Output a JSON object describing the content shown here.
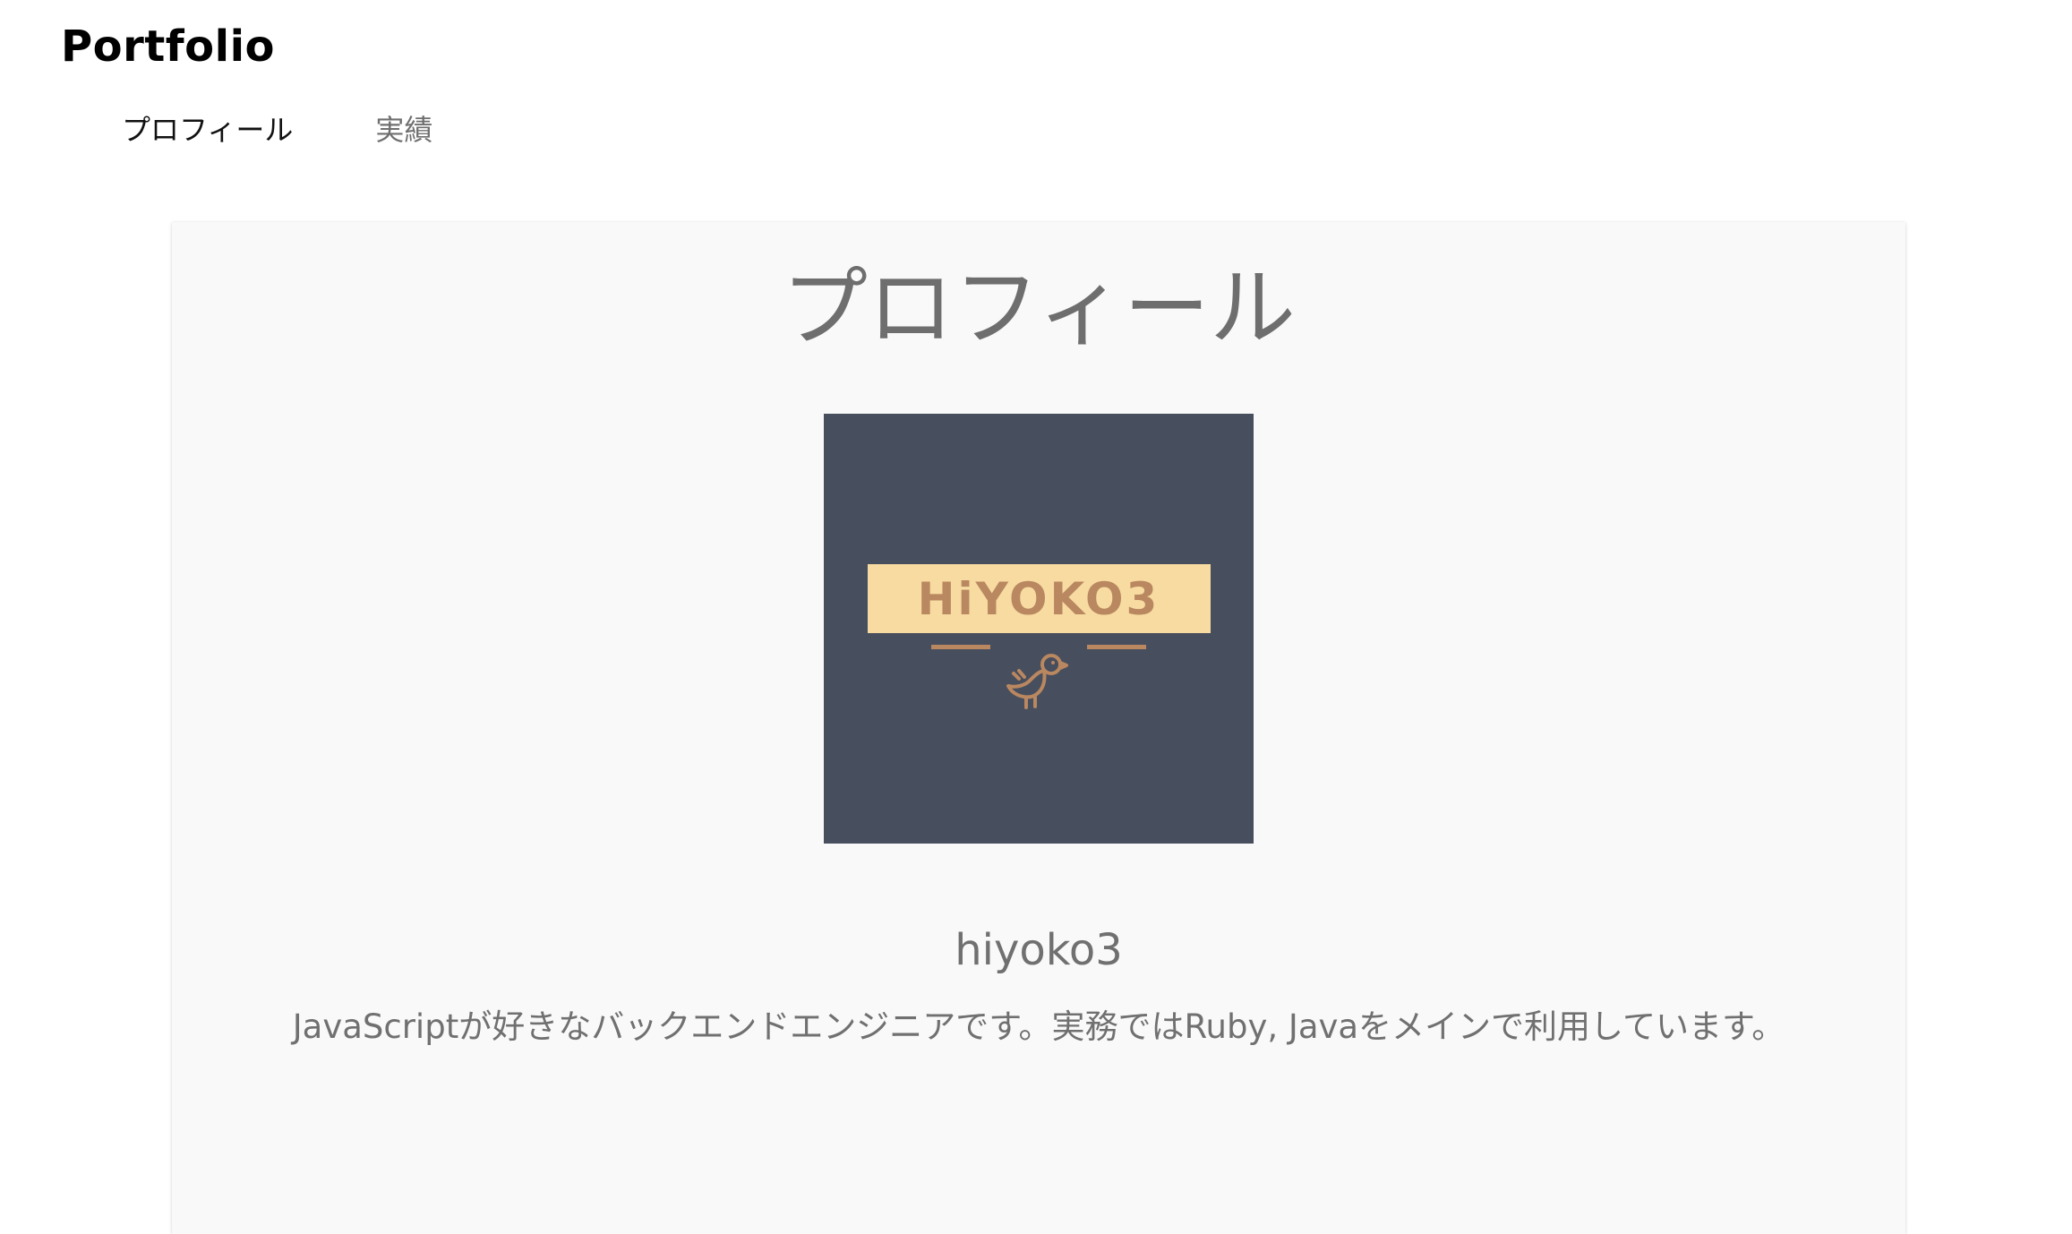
{
  "header": {
    "site_title": "Portfolio"
  },
  "nav": {
    "tabs": [
      {
        "label": "プロフィール",
        "active": true
      },
      {
        "label": "実績",
        "active": false
      }
    ]
  },
  "profile": {
    "heading": "プロフィール",
    "avatar": {
      "logo_text": "HiYOKO3",
      "icon": "chick-icon",
      "background_color": "#474e5d",
      "banner_color": "#f7dba0",
      "accent_color": "#b98760"
    },
    "username": "hiyoko3",
    "bio": "JavaScriptが好きなバックエンドエンジニアです。実務ではRuby, Javaをメインで利用しています。"
  }
}
